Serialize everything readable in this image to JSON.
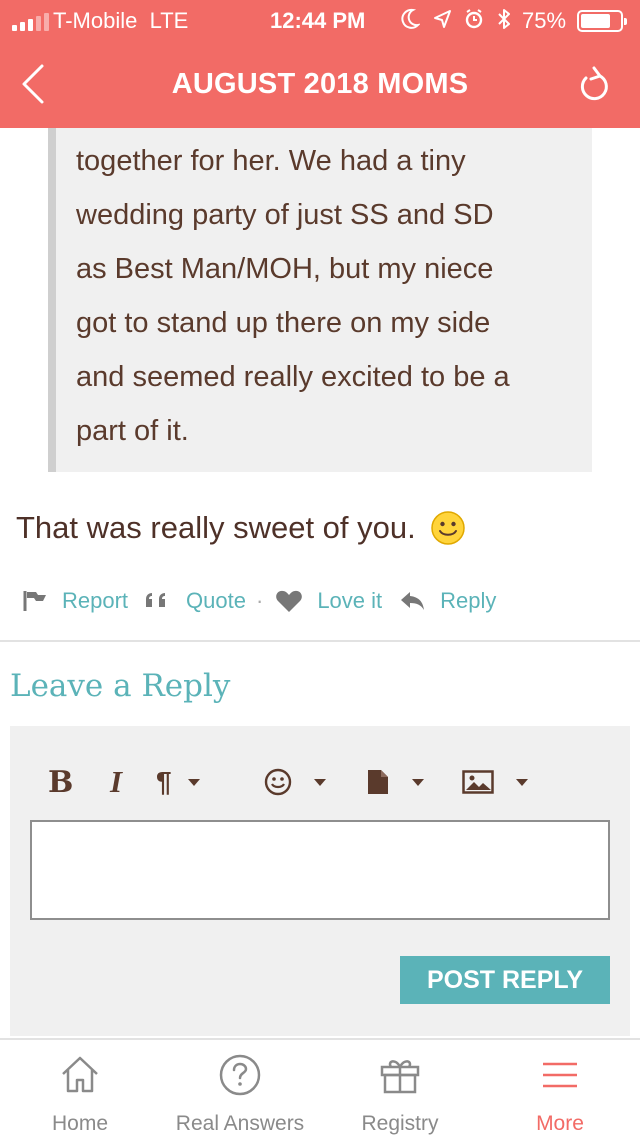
{
  "status_bar": {
    "carrier": "T-Mobile",
    "network": "LTE",
    "time": "12:44 PM",
    "battery": "75%",
    "battery_level": 0.75,
    "icons": [
      "moon-icon",
      "location-arrow-icon",
      "alarm-icon",
      "bluetooth-icon"
    ]
  },
  "header": {
    "title": "AUGUST 2018 MOMS",
    "back_icon": "chevron-left-icon",
    "refresh_icon": "refresh-icon",
    "background": "#f26b66"
  },
  "quote": {
    "lines": [
      "together for her. We had a tiny",
      "wedding party of just SS and SD",
      "as Best Man/MOH, but my niece",
      "got to stand up there on my side",
      "and seemed really excited to be a",
      "part of it."
    ]
  },
  "post": {
    "text": "That was really sweet of you.",
    "emoji": "smiley-icon"
  },
  "actions": {
    "report": "Report",
    "quote": "Quote",
    "separator": "·",
    "love": "Love it",
    "reply": "Reply",
    "color": "#5bb3b8"
  },
  "reply_form": {
    "title": "Leave a Reply",
    "toolbar": {
      "bold": "B",
      "italic": "I",
      "paragraph": "¶"
    },
    "textarea_value": "",
    "submit_label": "POST REPLY"
  },
  "tabbar": {
    "tabs": [
      {
        "label": "Home",
        "icon": "home-icon",
        "active": false
      },
      {
        "label": "Real Answers",
        "icon": "question-circle-icon",
        "active": false
      },
      {
        "label": "Registry",
        "icon": "gift-icon",
        "active": false
      },
      {
        "label": "More",
        "icon": "menu-icon",
        "active": true
      }
    ],
    "active_color": "#f26b66"
  }
}
